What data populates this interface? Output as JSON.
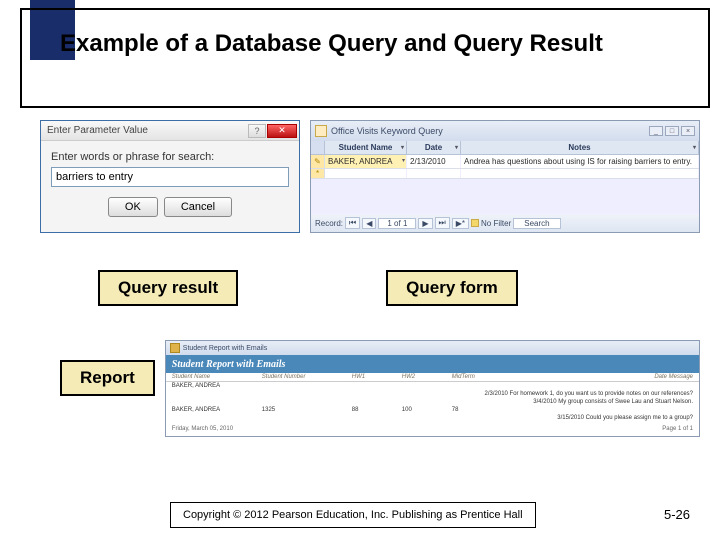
{
  "title": "Example of a Database Query and Query Result",
  "dialog": {
    "title": "Enter Parameter Value",
    "label": "Enter words or phrase for search:",
    "value": "barriers to entry",
    "ok": "OK",
    "cancel": "Cancel"
  },
  "access": {
    "tab": "Office Visits Keyword Query",
    "columns": [
      "Student Name",
      "Date",
      "Notes"
    ],
    "row": {
      "name": "BAKER, ANDREA",
      "date": "2/13/2010",
      "notes": "Andrea has questions about using IS for raising barriers to entry."
    },
    "nav": {
      "label": "Record:",
      "first": "⏮",
      "prev": "◀",
      "pos": "1 of 1",
      "next": "▶",
      "last": "⏭",
      "new": "▶*",
      "filter": "No Filter",
      "search": "Search"
    },
    "winmin": "_",
    "winmax": "□",
    "winclose": "×"
  },
  "labels": {
    "query_result": "Query result",
    "query_form": "Query form",
    "report": "Report"
  },
  "report": {
    "tab": "Student Report with Emails",
    "title": "Student Report with Emails",
    "headers": [
      "Student Name",
      "Student Number",
      "HW1",
      "HW2",
      "MidTerm",
      "Date Message"
    ],
    "group_name": "BAKER, ANDREA",
    "notes": [
      "2/3/2010 For homework 1, do you want us to provide notes on our references?",
      "3/4/2010 My group consists of Swee Lau and Stuart Nelson.",
      "3/15/2010 Could you please assign me to a group?"
    ],
    "row": [
      "BAKER, ANDREA",
      "1325",
      "88",
      "100",
      "78",
      ""
    ],
    "date_printed": "Friday, March 05, 2010",
    "page": "Page 1 of 1"
  },
  "footer": "Copyright © 2012 Pearson Education, Inc. Publishing as Prentice Hall",
  "slide_number": "5-26"
}
